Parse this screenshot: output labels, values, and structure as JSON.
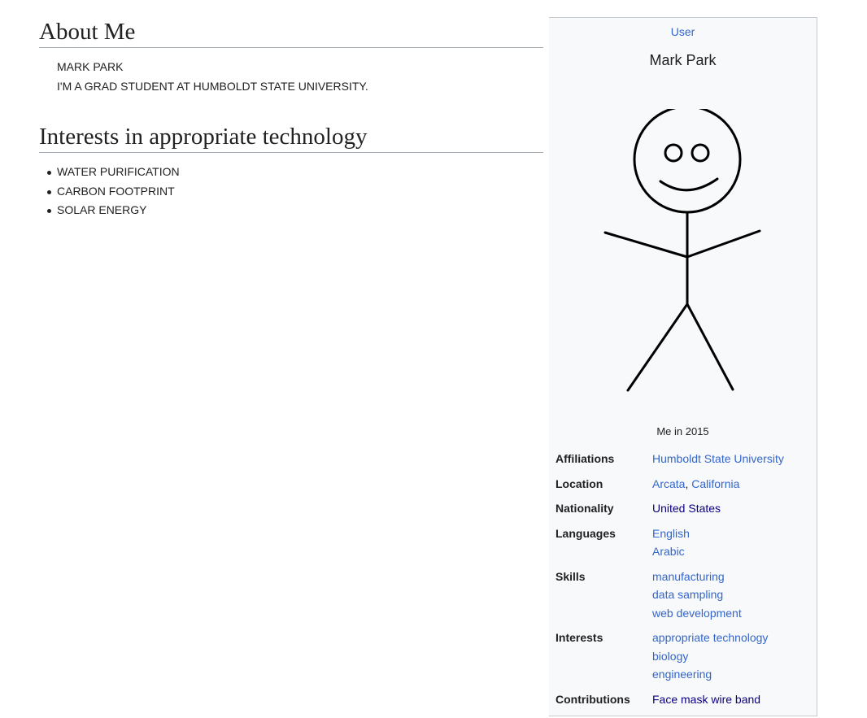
{
  "about": {
    "heading": "About Me",
    "lines": [
      "Mark Park",
      "I'm a grad student at Humboldt State University."
    ]
  },
  "interests_section": {
    "heading": "Interests in appropriate technology",
    "items": [
      "Water purification",
      "Carbon footprint",
      "Solar energy"
    ]
  },
  "infobox": {
    "type_label": "User",
    "name": "Mark Park",
    "image_icon": "stick-figure-avatar",
    "caption": "Me in 2015",
    "affiliations": {
      "label": "Affiliations",
      "values": [
        "Humboldt State University"
      ]
    },
    "location": {
      "label": "Location",
      "city": "Arcata",
      "separator": ",",
      "region": "California"
    },
    "nationality": {
      "label": "Nationality",
      "values": [
        "United States"
      ]
    },
    "languages": {
      "label": "Languages",
      "values": [
        "English",
        "Arabic"
      ]
    },
    "skills": {
      "label": "Skills",
      "values": [
        "manufacturing",
        "data sampling",
        "web development"
      ]
    },
    "interests": {
      "label": "Interests",
      "values": [
        "appropriate technology",
        "biology",
        "engineering"
      ]
    },
    "contributions": {
      "label": "Contributions",
      "values": [
        "Face mask wire band"
      ]
    }
  },
  "colors": {
    "link": "#3366cc",
    "visited_link": "#0b0080",
    "infobox_bg": "#f8f9fa",
    "rule": "#a2a9b1"
  }
}
